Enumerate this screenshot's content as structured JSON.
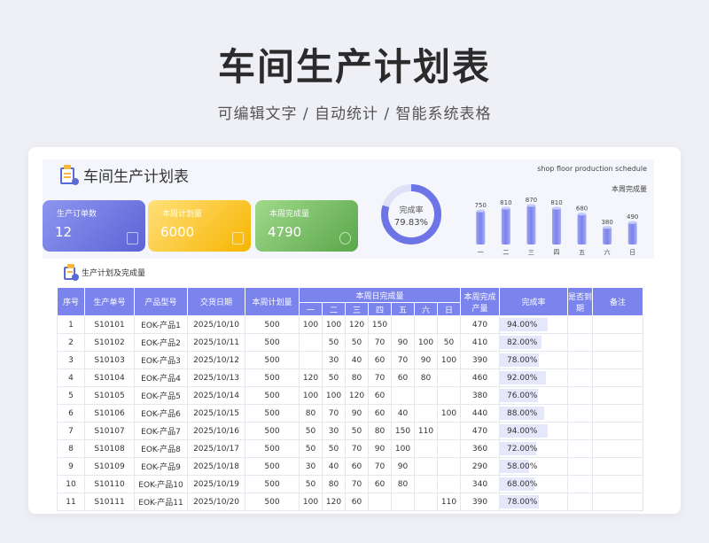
{
  "hero": {
    "title": "车间生产计划表",
    "subtitle": "可编辑文字 / 自动统计 / 智能系统表格"
  },
  "sheet": {
    "title": "车间生产计划表",
    "en_title": "shop floor production schedule"
  },
  "kpis": [
    {
      "label": "生产订单数",
      "value": "12",
      "icon": "clipboard-icon"
    },
    {
      "label": "本周计划量",
      "value": "6000",
      "icon": "grid-icon"
    },
    {
      "label": "本周完成量",
      "value": "4790",
      "icon": "pie-icon"
    }
  ],
  "donut": {
    "label": "完成率",
    "value_text": "79.83%",
    "value": 0.7983,
    "colors": {
      "fill": "#6c74e6",
      "track": "#dfe2f7"
    }
  },
  "chart_data": {
    "type": "bar",
    "title": "本周完成量",
    "categories": [
      "一",
      "二",
      "三",
      "四",
      "五",
      "六",
      "日"
    ],
    "values": [
      750,
      810,
      870,
      810,
      680,
      380,
      490
    ],
    "ylim": [
      0,
      870
    ]
  },
  "section": {
    "title": "生产计划及完成量"
  },
  "table": {
    "headers": {
      "seq": "序号",
      "order": "生产单号",
      "model": "产品型号",
      "date": "交货日期",
      "plan": "本周计划量",
      "daily": "本周日完成量",
      "days": [
        "一",
        "二",
        "三",
        "四",
        "五",
        "六",
        "日"
      ],
      "weekly": "本周完成产量",
      "rate": "完成率",
      "due": "是否到期",
      "note": "备注"
    },
    "rows": [
      [
        "1",
        "S10101",
        "EOK-产品1",
        "2025/10/10",
        "500",
        "100",
        "100",
        "120",
        "150",
        "",
        "",
        "",
        "470",
        "94.00%",
        "",
        ""
      ],
      [
        "2",
        "S10102",
        "EOK-产品2",
        "2025/10/11",
        "500",
        "",
        "50",
        "50",
        "70",
        "90",
        "100",
        "50",
        "410",
        "82.00%",
        "",
        ""
      ],
      [
        "3",
        "S10103",
        "EOK-产品3",
        "2025/10/12",
        "500",
        "",
        "30",
        "40",
        "60",
        "70",
        "90",
        "100",
        "390",
        "78.00%",
        "",
        ""
      ],
      [
        "4",
        "S10104",
        "EOK-产品4",
        "2025/10/13",
        "500",
        "120",
        "50",
        "80",
        "70",
        "60",
        "80",
        "",
        "460",
        "92.00%",
        "",
        ""
      ],
      [
        "5",
        "S10105",
        "EOK-产品5",
        "2025/10/14",
        "500",
        "100",
        "100",
        "120",
        "60",
        "",
        "",
        "",
        "380",
        "76.00%",
        "",
        ""
      ],
      [
        "6",
        "S10106",
        "EOK-产品6",
        "2025/10/15",
        "500",
        "80",
        "70",
        "90",
        "60",
        "40",
        "",
        "100",
        "440",
        "88.00%",
        "",
        ""
      ],
      [
        "7",
        "S10107",
        "EOK-产品7",
        "2025/10/16",
        "500",
        "50",
        "30",
        "50",
        "80",
        "150",
        "110",
        "",
        "470",
        "94.00%",
        "",
        ""
      ],
      [
        "8",
        "S10108",
        "EOK-产品8",
        "2025/10/17",
        "500",
        "50",
        "50",
        "70",
        "90",
        "100",
        "",
        "",
        "360",
        "72.00%",
        "",
        ""
      ],
      [
        "9",
        "S10109",
        "EOK-产品9",
        "2025/10/18",
        "500",
        "30",
        "40",
        "60",
        "70",
        "90",
        "",
        "",
        "290",
        "58.00%",
        "",
        ""
      ],
      [
        "10",
        "S10110",
        "EOK-产品10",
        "2025/10/19",
        "500",
        "50",
        "80",
        "70",
        "60",
        "80",
        "",
        "",
        "340",
        "68.00%",
        "",
        ""
      ],
      [
        "11",
        "S10111",
        "EOK-产品11",
        "2025/10/20",
        "500",
        "100",
        "120",
        "60",
        "",
        "",
        "",
        "110",
        "390",
        "78.00%",
        "",
        ""
      ]
    ],
    "rates": [
      0.94,
      0.82,
      0.78,
      0.92,
      0.76,
      0.88,
      0.94,
      0.72,
      0.58,
      0.68,
      0.78
    ]
  },
  "colors": {
    "header_bg": "#7b83ec",
    "bar": "#7b83ec",
    "rate_fill": "#e5e8fb"
  }
}
